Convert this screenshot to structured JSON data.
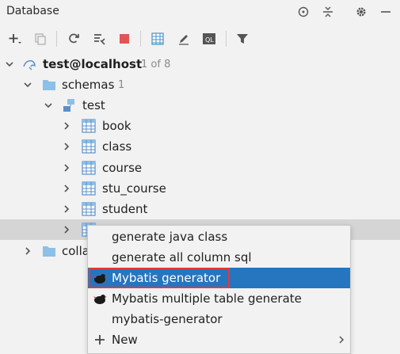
{
  "window": {
    "title": "Database"
  },
  "tree": {
    "connection": {
      "label": "test@localhost",
      "count": "1 of 8"
    },
    "schemas": {
      "label": "schemas",
      "count": "1"
    },
    "schema": {
      "label": "test"
    },
    "tables": [
      "book",
      "class",
      "course",
      "stu_course",
      "student"
    ],
    "collapsed_label": "colla"
  },
  "context_menu": {
    "items": [
      {
        "label": "generate java class"
      },
      {
        "label": "generate all column sql"
      },
      {
        "label": "Mybatis generator"
      },
      {
        "label": "Mybatis multiple table generate"
      },
      {
        "label": "mybatis-generator"
      },
      {
        "label": "New"
      }
    ]
  },
  "colors": {
    "selection": "#2675bf",
    "highlight_border": "#e53935",
    "stop": "#e05555"
  }
}
